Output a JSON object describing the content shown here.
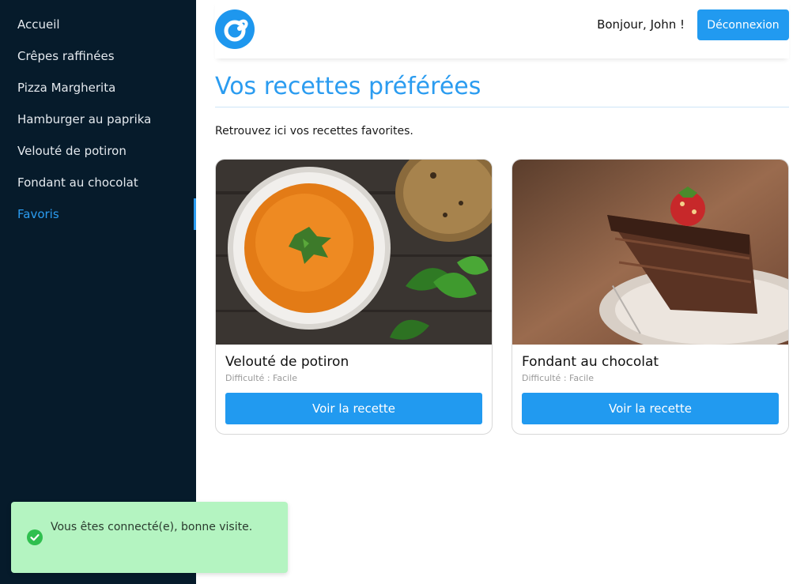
{
  "sidebar": {
    "items": [
      {
        "label": "Accueil"
      },
      {
        "label": "Crêpes raffinées"
      },
      {
        "label": "Pizza Margherita"
      },
      {
        "label": "Hamburger au paprika"
      },
      {
        "label": "Velouté de potiron"
      },
      {
        "label": "Fondant au chocolat"
      },
      {
        "label": "Favoris"
      }
    ],
    "active_index": 6
  },
  "header": {
    "logo_icon": "brand-logo-icon",
    "greeting": "Bonjour, John !",
    "logout_label": "Déconnexion"
  },
  "main": {
    "title": "Vos recettes préférées",
    "subtitle": "Retrouvez ici vos recettes favorites."
  },
  "recipes": [
    {
      "title": "Velouté de potiron",
      "difficulty": "Difficulté : Facile",
      "button_label": "Voir la recette",
      "image": "pumpkin-soup-photo"
    },
    {
      "title": "Fondant au chocolat",
      "difficulty": "Difficulté : Facile",
      "button_label": "Voir la recette",
      "image": "chocolate-cake-photo"
    }
  ],
  "toast": {
    "icon": "check-circle-icon",
    "message": "Vous êtes connecté(e), bonne visite."
  },
  "colors": {
    "accent": "#219af0",
    "sidebar_bg": "#061b2b",
    "toast_bg": "#b4f4c1",
    "success": "#2fbf4f"
  }
}
